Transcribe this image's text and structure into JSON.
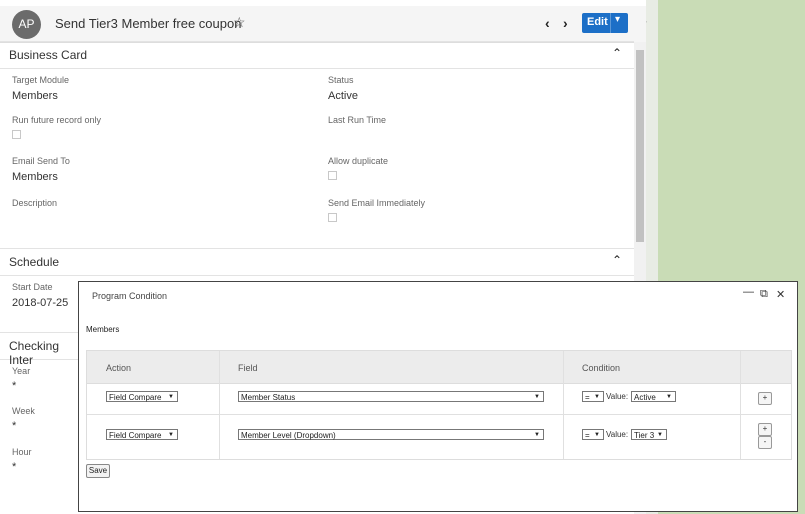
{
  "header": {
    "avatar_initials": "AP",
    "title": "Send Tier3 Member free coupon",
    "edit_label": "Edit",
    "accent_color": "#1c6fc7"
  },
  "business_card": {
    "title": "Business Card",
    "fields": {
      "target_module": {
        "label": "Target Module",
        "value": "Members"
      },
      "status": {
        "label": "Status",
        "value": "Active"
      },
      "run_future": {
        "label": "Run future record only",
        "checked": false
      },
      "last_run": {
        "label": "Last Run Time",
        "value": ""
      },
      "email_send_to": {
        "label": "Email Send To",
        "value": "Members"
      },
      "allow_duplicate": {
        "label": "Allow duplicate",
        "checked": false
      },
      "description": {
        "label": "Description",
        "value": ""
      },
      "send_immediately": {
        "label": "Send Email Immediately",
        "checked": false
      }
    }
  },
  "schedule": {
    "title": "Schedule",
    "start_date_label": "Start Date",
    "start_date": "2018-07-25"
  },
  "checking_interval": {
    "title": "Checking Inter",
    "year_label": "Year",
    "year_value": "*",
    "week_label": "Week",
    "week_value": "*",
    "hour_label": "Hour",
    "hour_value": "*"
  },
  "modal": {
    "title": "Program Condition",
    "members_label": "Members",
    "columns": [
      "Action",
      "Field",
      "Condition"
    ],
    "rows": [
      {
        "action": "Field Compare",
        "field": "Member Status",
        "operator": "=",
        "value_label": "Value:",
        "value": "Active"
      },
      {
        "action": "Field Compare",
        "field": "Member Level (Dropdown)",
        "operator": "=",
        "value_label": "Value:",
        "value": "Tier 3"
      }
    ],
    "save_label": "Save"
  }
}
